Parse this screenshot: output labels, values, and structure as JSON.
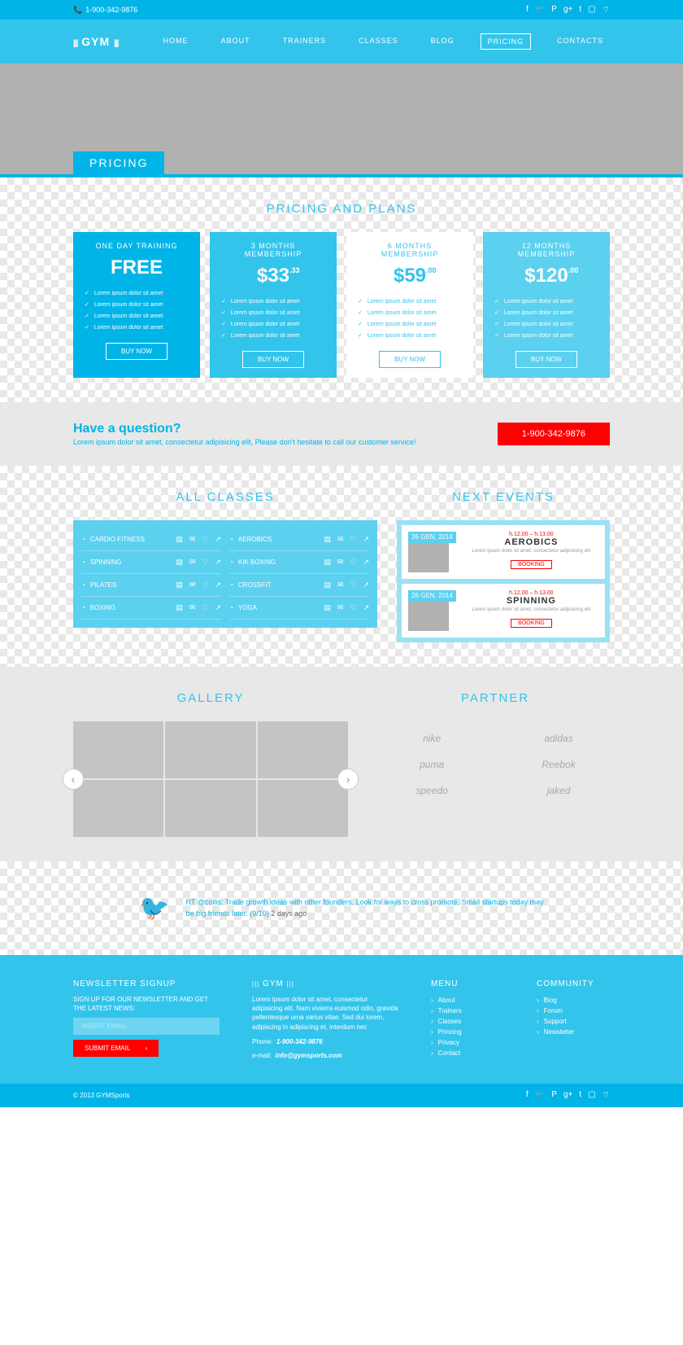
{
  "topbar": {
    "phone": "1-900-342-9876"
  },
  "logo": "GYM",
  "nav": [
    "HOME",
    "ABOUT",
    "TRAINERS",
    "CLASSES",
    "BLOG",
    "PRICING",
    "CONTACTS"
  ],
  "hero_tab": "PRICING",
  "pricing": {
    "title": "PRICING AND PLANS",
    "cards": [
      {
        "name": "ONE DAY TRAINING",
        "price": "FREE",
        "cents": "",
        "feat": [
          "Lorem ipsum dolor sit amet",
          "Lorem ipsum dolor sit amet",
          "Lorem ipsum dolor sit amet",
          "Lorem ipsum dolor sit amet"
        ],
        "btn": "BUY NOW"
      },
      {
        "name": "3 MONTHS MEMBERSHIP",
        "price": "$33",
        "cents": ".33",
        "feat": [
          "Lorem ipsum dolor sit amet",
          "Lorem ipsum dolor sit amet",
          "Lorem ipsum dolor sit amet",
          "Lorem ipsum dolor sit amet"
        ],
        "btn": "BUY NOW"
      },
      {
        "name": "6 MONTHS MEMBERSHIP",
        "price": "$59",
        "cents": ".00",
        "feat": [
          "Lorem ipsum dolor sit amet",
          "Lorem ipsum dolor sit amet",
          "Lorem ipsum dolor sit amet",
          "Lorem ipsum dolor sit amet"
        ],
        "btn": "BUY NOW"
      },
      {
        "name": "12 MONTHS MEMBERSHIP",
        "price": "$120",
        "cents": ".00",
        "feat": [
          "Lorem ipsum dolor sit amet",
          "Lorem ipsum dolor sit amet",
          "Lorem ipsum dolor sit amet",
          "Lorem ipsum dolor sit amet"
        ],
        "btn": "BUY NOW"
      }
    ]
  },
  "question": {
    "title": "Have a question?",
    "sub": "Lorem ipsum dolor sit amet, consectetur adipisicing elit, Please don't hesitate to call our customer service!",
    "phone": "1-900-342-9876"
  },
  "classes": {
    "title": "ALL CLASSES",
    "left": [
      "CARDIO FITNESS",
      "SPINNING",
      "PILATES",
      "BOXING"
    ],
    "right": [
      "AEROBICS",
      "KIK BOXING",
      "CROSSFIT",
      "YOGA"
    ]
  },
  "events": {
    "title": "NEXT EVENTS",
    "items": [
      {
        "date": "26 GEN, 2014",
        "time": "h.12.00 – h.13.00",
        "name": "AEROBICS",
        "desc": "Lorem ipsum dolor sit amet, consectetur adipisicing elit",
        "btn": "BOOKING"
      },
      {
        "date": "26 GEN, 2014",
        "time": "h.12.00 – h.13.00",
        "name": "SPINNING",
        "desc": "Lorem ipsum dolor sit amet, consectetur adipisicing elit",
        "btn": "BOOKING"
      }
    ]
  },
  "gallery": {
    "title": "GALLERY"
  },
  "partner": {
    "title": "PARTNER",
    "items": [
      "nike",
      "adidas",
      "puma",
      "Reebok",
      "speedo",
      "jaked"
    ]
  },
  "tweet": {
    "text": "RT @collis: Trade growth ideas with other founders. Look for ways to cross promote. Small startups today may be big friends later. (9/10)",
    "time": "2 days ago"
  },
  "footer": {
    "newsletter": {
      "title": "NEWSLETTER SIGNUP",
      "sub": "SIGN UP FOR OUR NEWSLETTER AND GET THE LATEST NEWS:",
      "placeholder": "INSERT EMAIL",
      "btn": "SUBMIT EMAIL"
    },
    "about": {
      "title": "GYM",
      "text": "Lorem ipsum dolor sit amet, consectetur adipisicing elit. Nam vivierra euismod odio, gravida pellentesque urna varius vitae. Sed dui lorem, adipiscing in adipiscing et, interdum nec",
      "phone_lbl": "Phone:",
      "phone": "1-900-342-9876",
      "email_lbl": "e-mail:",
      "email": "info@gymsports.com"
    },
    "menu": {
      "title": "MENU",
      "items": [
        "About",
        "Trainers",
        "Classes",
        "Princing",
        "Privacy",
        "Contact"
      ]
    },
    "community": {
      "title": "COMMUNITY",
      "items": [
        "Blog",
        "Forum",
        "Support",
        "Newsletter"
      ]
    }
  },
  "copyright": "© 2013  GYMSports"
}
